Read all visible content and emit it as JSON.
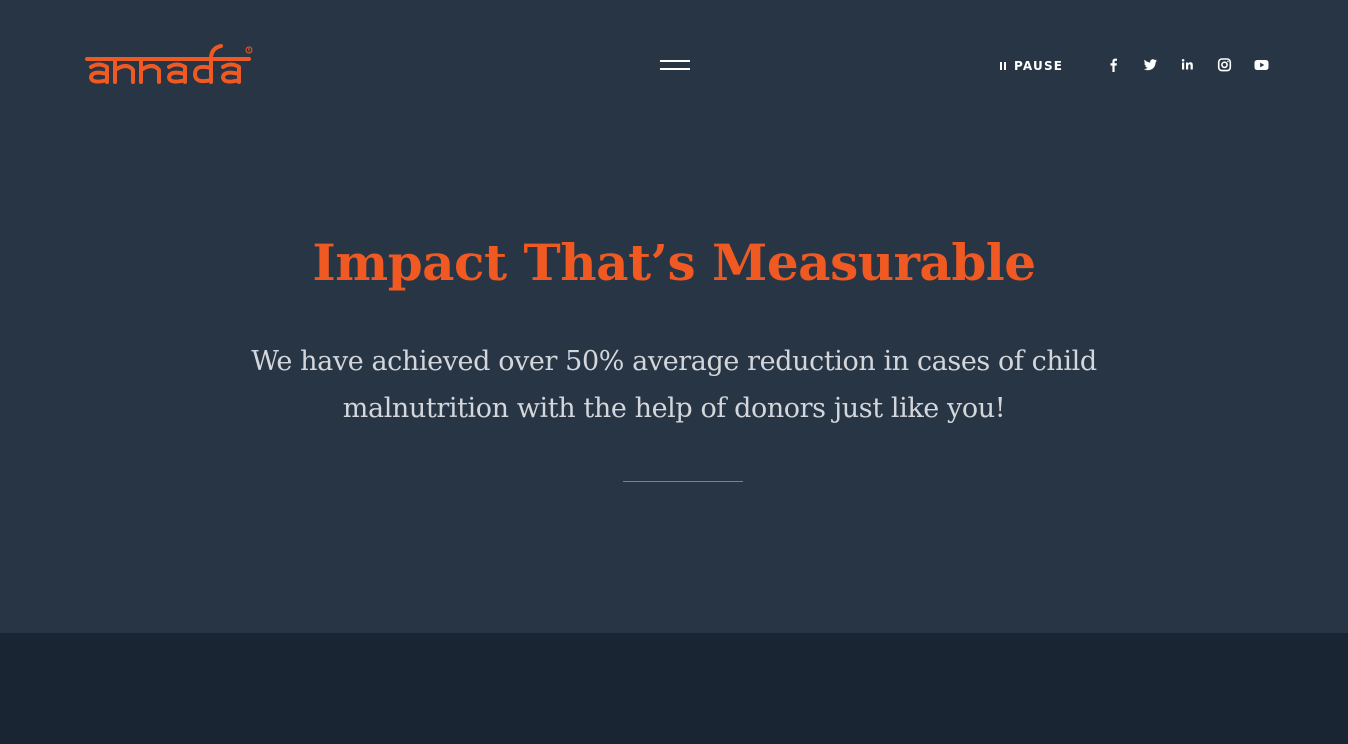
{
  "brand": {
    "name": "annada",
    "mark": "®",
    "color": "#f05a22"
  },
  "header": {
    "menu_icon": "hamburger-icon",
    "pause_label": "PAUSE",
    "pause_icon": "pause-icon",
    "social": [
      {
        "name": "facebook",
        "icon": "facebook-icon"
      },
      {
        "name": "twitter",
        "icon": "twitter-icon"
      },
      {
        "name": "linkedin",
        "icon": "linkedin-icon"
      },
      {
        "name": "instagram",
        "icon": "instagram-icon"
      },
      {
        "name": "youtube",
        "icon": "youtube-icon"
      }
    ]
  },
  "hero": {
    "title": "Impact That’s Measurable",
    "text": "We have achieved over 50% average reduction in cases of child malnutrition with the help of donors just like you!"
  },
  "colors": {
    "background": "#283544",
    "footer_band": "#1a2533",
    "accent": "#f05a22",
    "text": "#d3d6db"
  }
}
